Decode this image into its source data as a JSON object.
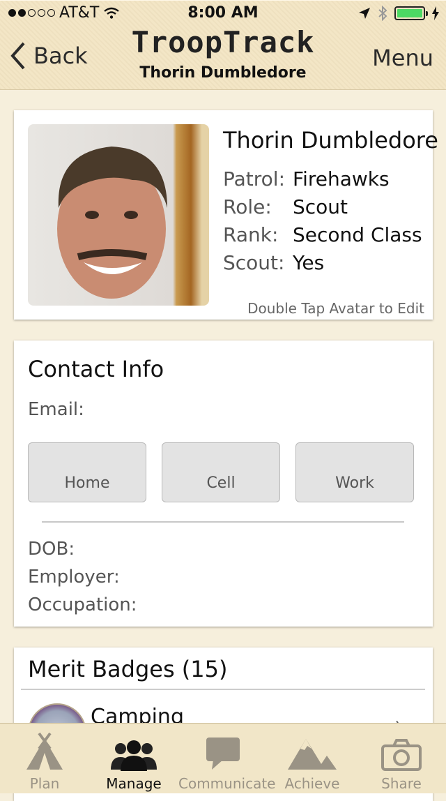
{
  "status": {
    "carrier": "AT&T",
    "time": "8:00 AM",
    "signal_bars": 2
  },
  "header": {
    "back_label": "Back",
    "logo": "TroopTrack",
    "subtitle": "Thorin Dumbledore",
    "menu_label": "Menu"
  },
  "profile": {
    "name": "Thorin Dumbledore",
    "fields": [
      {
        "label": "Patrol:",
        "value": "Firehawks"
      },
      {
        "label": "Role:",
        "value": "Scout"
      },
      {
        "label": "Rank:",
        "value": "Second Class"
      },
      {
        "label": "Scout:",
        "value": "Yes"
      }
    ],
    "hint": "Double Tap Avatar to Edit"
  },
  "contact": {
    "title": "Contact Info",
    "email_label": "Email:",
    "buttons": [
      "Home",
      "Cell",
      "Work"
    ],
    "dob_label": "DOB:",
    "employer_label": "Employer:",
    "occupation_label": "Occupation:"
  },
  "badges": {
    "title": "Merit Badges (15)",
    "items": [
      {
        "name": "Camping"
      }
    ]
  },
  "tabs": [
    {
      "label": "Plan",
      "icon": "tent-icon"
    },
    {
      "label": "Manage",
      "icon": "people-icon"
    },
    {
      "label": "Communicate",
      "icon": "speech-bubble-icon"
    },
    {
      "label": "Achieve",
      "icon": "mountain-icon"
    },
    {
      "label": "Share",
      "icon": "camera-icon"
    }
  ],
  "colors": {
    "accent_battery": "#4cd964",
    "background": "#f6efdc"
  }
}
